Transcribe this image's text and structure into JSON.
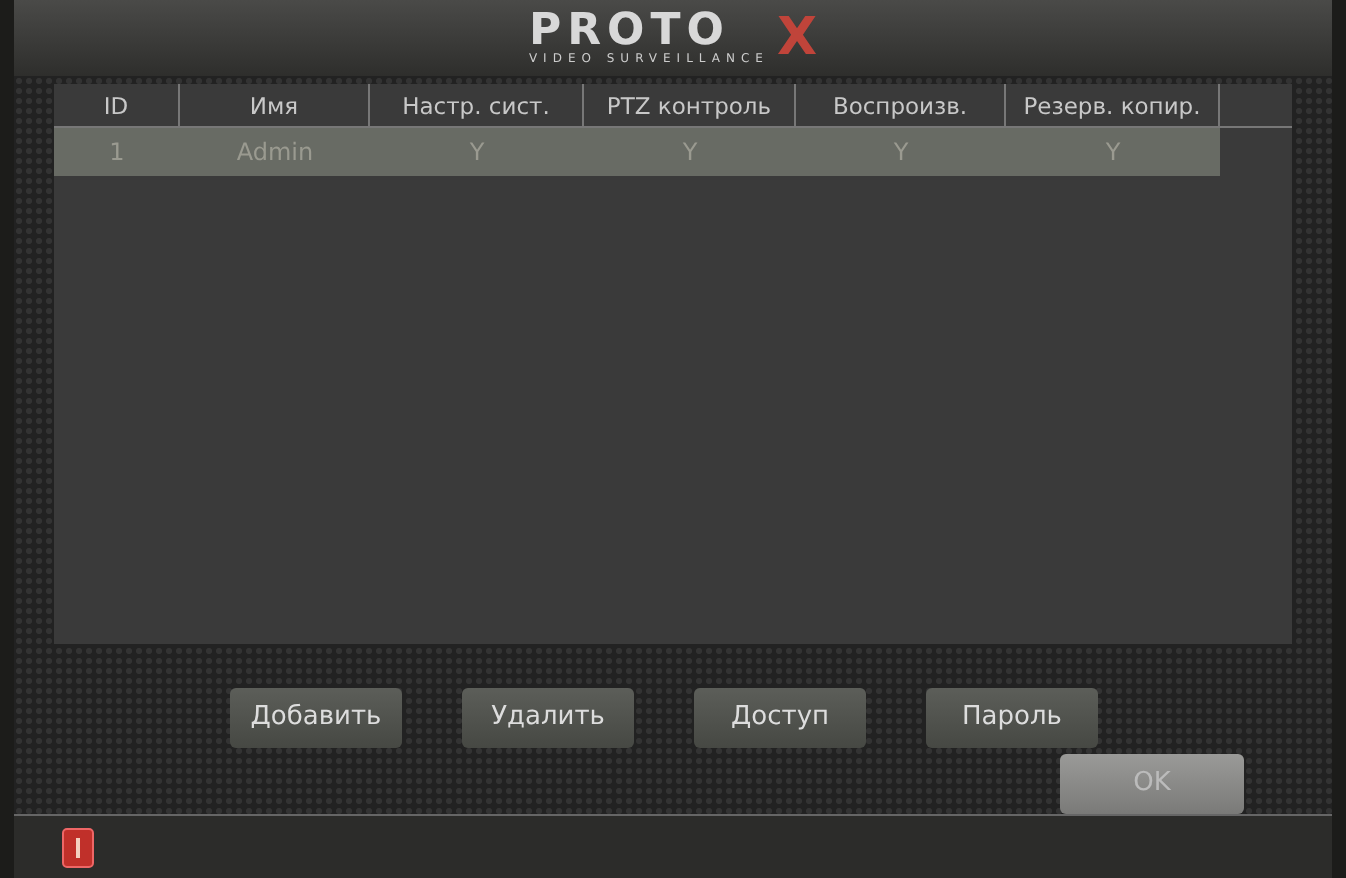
{
  "header": {
    "logo": "PROTO",
    "logo_mark": "X",
    "tagline": "VIDEO SURVEILLANCE"
  },
  "table": {
    "columns": [
      "ID",
      "Имя",
      "Настр. сист.",
      "PTZ контроль",
      "Воспроизв.",
      "Резерв. копир."
    ],
    "rows": [
      {
        "cells": [
          "1",
          "Admin",
          "Y",
          "Y",
          "Y",
          "Y"
        ],
        "selected": true
      }
    ]
  },
  "buttons": [
    "Добавить",
    "Удалить",
    "Доступ",
    "Пароль"
  ],
  "ok_button": "OK"
}
